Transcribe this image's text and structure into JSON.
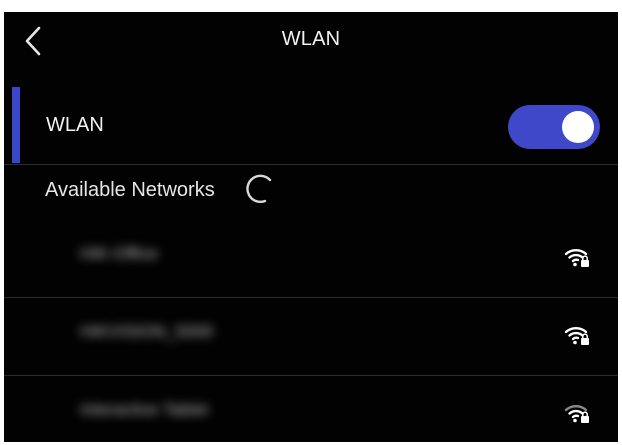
{
  "header": {
    "title": "WLAN",
    "back_icon": "chevron-left-icon"
  },
  "wlan_toggle": {
    "label": "WLAN",
    "enabled": true,
    "accent_color": "#3f48c9"
  },
  "networks_section": {
    "label": "Available Networks",
    "loading_icon": "loading-spinner-icon",
    "items": [
      {
        "ssid": "HIK-Office",
        "secured": true,
        "signal_icon": "wifi-locked-icon"
      },
      {
        "ssid": "HIKVISION_5000",
        "secured": true,
        "signal_icon": "wifi-locked-icon"
      },
      {
        "ssid": "Interactive Tablet",
        "secured": true,
        "signal_icon": "wifi-locked-icon"
      }
    ]
  }
}
